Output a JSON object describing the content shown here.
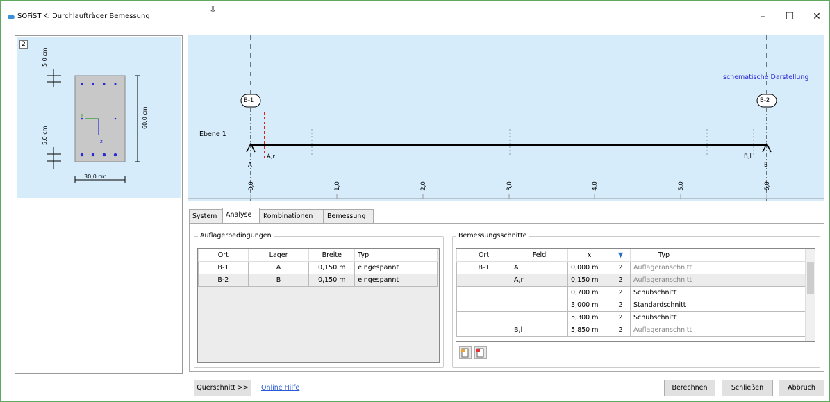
{
  "window": {
    "title": "SOFiSTiK: Durchlaufträger Bemessung"
  },
  "cross_section": {
    "number": "2",
    "dim_top": "5,0 cm",
    "dim_bottom": "5,0 cm",
    "height": "60,0 cm",
    "width": "30,0 cm",
    "axis_y": "y",
    "axis_z": "z"
  },
  "diagram": {
    "note": "schematische Darstellung",
    "level": "Ebene 1",
    "supports": [
      {
        "label": "B-1",
        "bearing": "A"
      },
      {
        "label": "B-2",
        "bearing": "B"
      }
    ],
    "section_left": "A,r",
    "section_right": "B,l",
    "ticks": [
      "0,0",
      "1,0",
      "2,0",
      "3,0",
      "4,0",
      "5,0",
      "6,0"
    ]
  },
  "tabs": [
    "System",
    "Analyse",
    "Kombinationen",
    "Bemessung"
  ],
  "active_tab": "Analyse",
  "supports_group": {
    "title": "Auflagerbedingungen",
    "columns": [
      "Ort",
      "Lager",
      "Breite",
      "Typ"
    ],
    "rows": [
      [
        "B-1",
        "A",
        "0,150 m",
        "eingespannt"
      ],
      [
        "B-2",
        "B",
        "0,150 m",
        "eingespannt"
      ]
    ]
  },
  "sections_group": {
    "title": "Bemessungsschnitte",
    "columns": [
      "Ort",
      "Feld",
      "x",
      "",
      "Typ"
    ],
    "rows": [
      [
        "B-1",
        "A",
        "0,000 m",
        "2",
        "Auflageranschnitt"
      ],
      [
        "",
        "A,r",
        "0,150 m",
        "2",
        "Auflageranschnitt"
      ],
      [
        "",
        "",
        "0,700 m",
        "2",
        "Schubschnitt"
      ],
      [
        "",
        "",
        "3,000 m",
        "2",
        "Standardschnitt"
      ],
      [
        "",
        "",
        "5,300 m",
        "2",
        "Schubschnitt"
      ],
      [
        "",
        "B,l",
        "5,850 m",
        "2",
        "Auflageranschnitt"
      ]
    ]
  },
  "footer": {
    "cross_section_button": "Querschnitt >>",
    "help_link": "Online Hilfe",
    "calculate": "Berechnen",
    "close": "Schließen",
    "cancel": "Abbruch"
  }
}
